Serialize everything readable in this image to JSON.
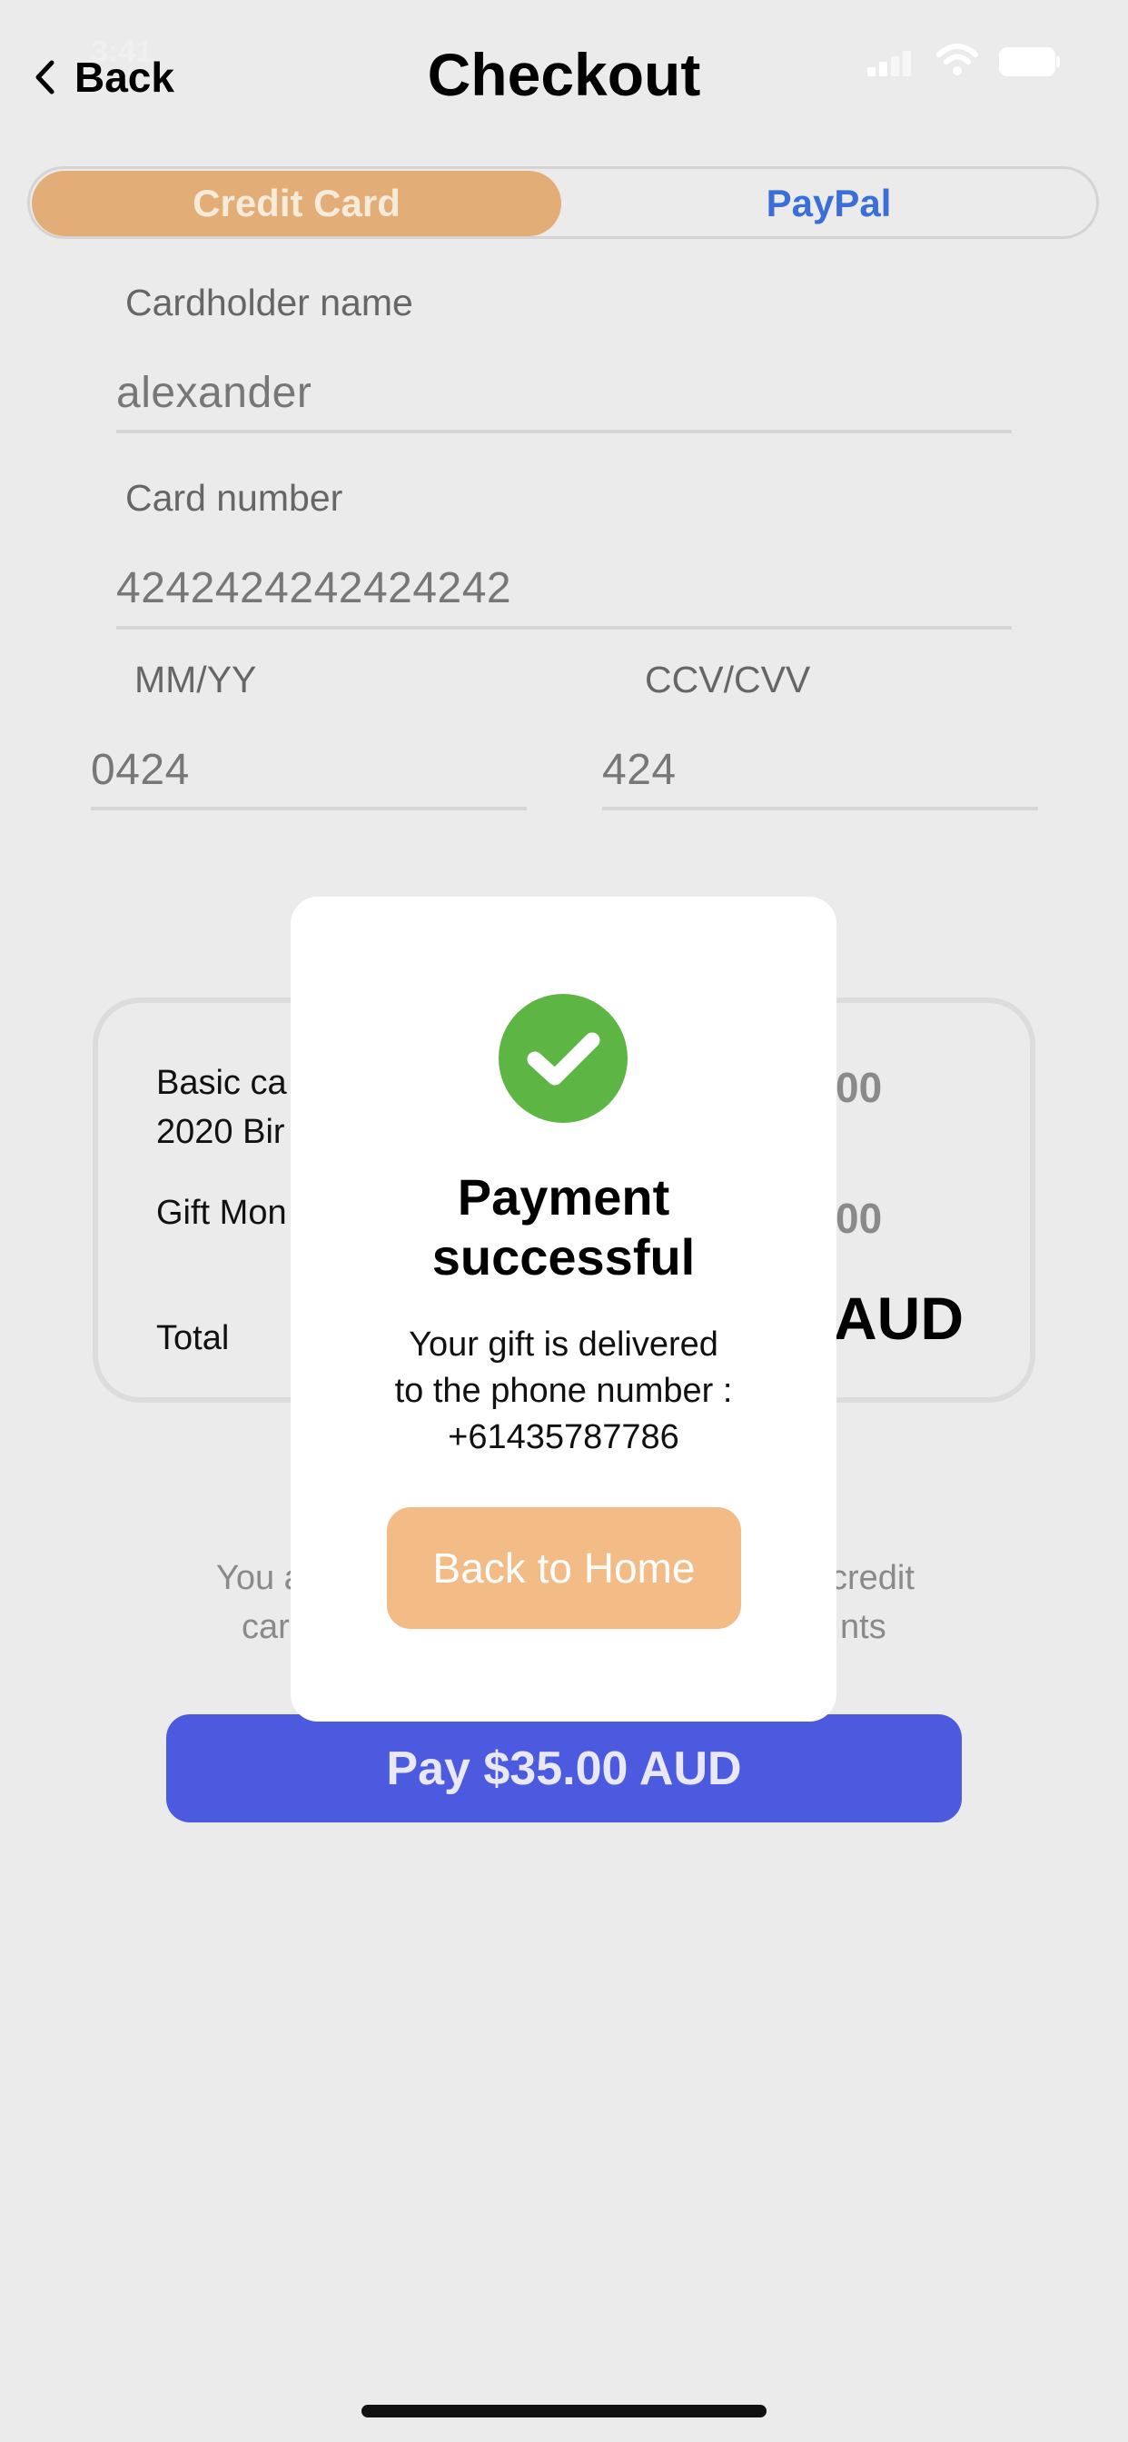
{
  "status_bar": {
    "time": "3:41"
  },
  "nav": {
    "back_label": "Back",
    "title": "Checkout"
  },
  "payment_tabs": {
    "active": "Credit Card",
    "other": "PayPal"
  },
  "form": {
    "cardholder": {
      "label": "Cardholder name",
      "value": "alexander"
    },
    "card_number": {
      "label": "Card number",
      "value": "4242424242424242"
    },
    "expiry": {
      "label": "MM/YY",
      "value": "0424"
    },
    "cvv": {
      "label": "CCV/CVV",
      "value": "424"
    }
  },
  "summary": {
    "item_line1": "Basic ca",
    "item_line2": "2020 Bir",
    "item_amount": "00",
    "gift_label": "Gift Mon",
    "gift_amount": "00",
    "total_label": "Total",
    "total_amount": "AUD"
  },
  "terms": {
    "line1_left": "You a",
    "line1_right": "credit",
    "line2_left": "car",
    "line2_right": "nts"
  },
  "pay_button": "Pay $35.00 AUD",
  "modal": {
    "title_line1": "Payment",
    "title_line2": "successful",
    "message_line1": "Your gift is delivered",
    "message_line2": "to the phone number :",
    "phone": "+61435787786",
    "button": "Back to Home"
  },
  "colors": {
    "accent_orange": "#e3ad78",
    "paypal_blue": "#3b6fd7",
    "pay_button": "#4c5adf",
    "success_green": "#5db543",
    "home_button": "#f3bc86"
  },
  "icons": [
    "chevron-left-icon",
    "signal-icon",
    "wifi-icon",
    "battery-icon",
    "checkmark-icon"
  ]
}
